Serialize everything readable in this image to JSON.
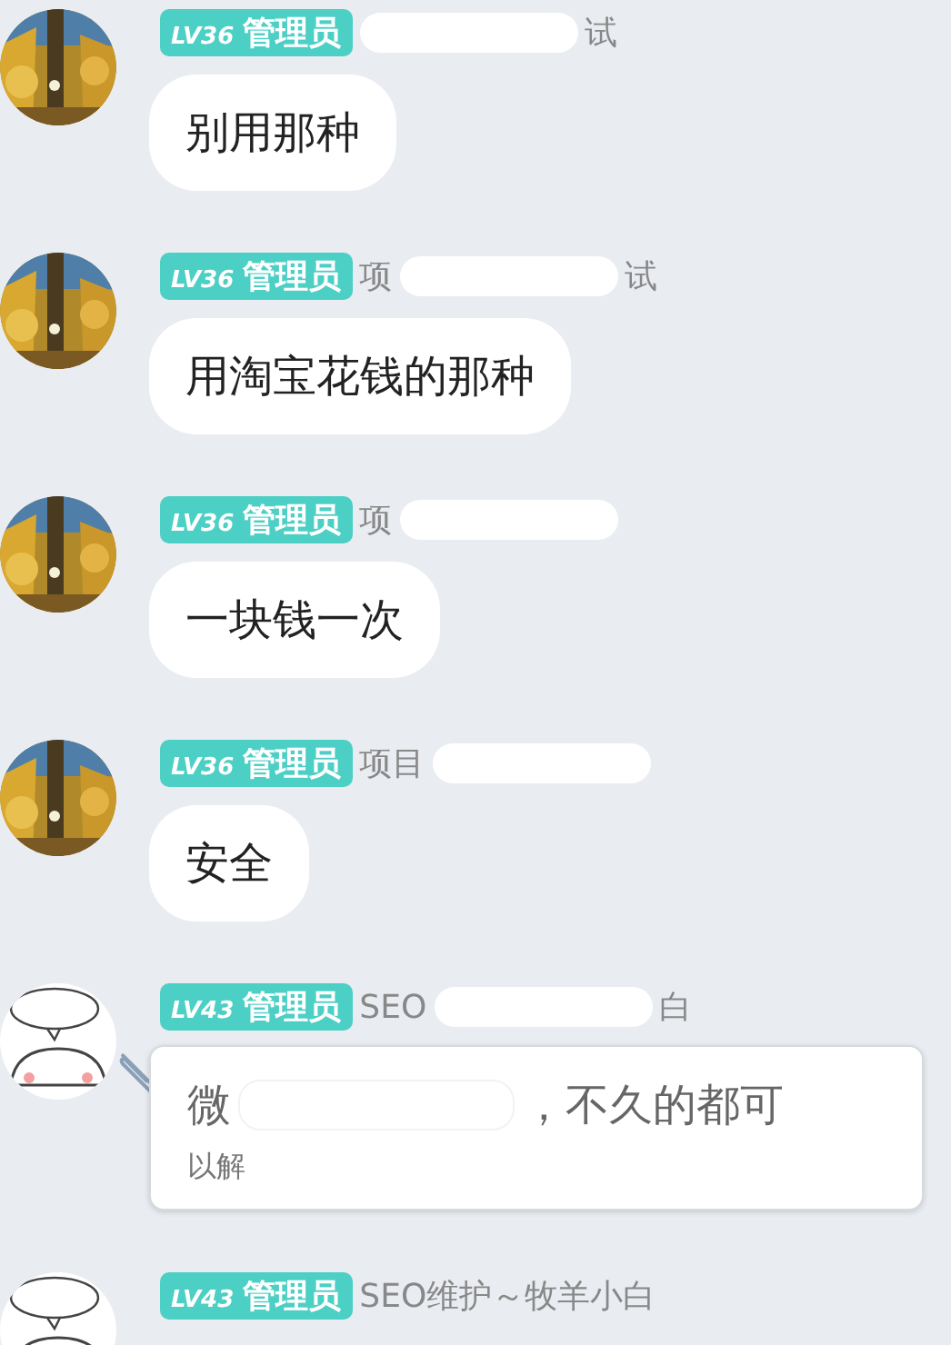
{
  "messages": [
    {
      "sender": {
        "level": "LV36",
        "role": "管理员",
        "name": [
          {
            "kind": "redacted"
          },
          {
            "kind": "text",
            "text": "试"
          }
        ]
      },
      "kind": "text",
      "text": "别用那种"
    },
    {
      "sender": {
        "level": "LV36",
        "role": "管理员",
        "name": [
          {
            "kind": "text",
            "text": "项"
          },
          {
            "kind": "redacted"
          },
          {
            "kind": "text",
            "text": "试"
          }
        ]
      },
      "kind": "text",
      "text": "用淘宝花钱的那种"
    },
    {
      "sender": {
        "level": "LV36",
        "role": "管理员",
        "name": [
          {
            "kind": "text",
            "text": "项"
          },
          {
            "kind": "redacted"
          }
        ]
      },
      "kind": "text",
      "text": "一块钱一次"
    },
    {
      "sender": {
        "level": "LV36",
        "role": "管理员",
        "name": [
          {
            "kind": "text",
            "text": "项目"
          },
          {
            "kind": "redacted"
          }
        ]
      },
      "kind": "text",
      "text": "安全"
    },
    {
      "avatar": {
        "kind": "cartoon"
      },
      "sender": {
        "level": "LV43",
        "role": "管理员",
        "name": [
          {
            "kind": "text",
            "text": "SEO"
          },
          {
            "kind": "redacted"
          },
          {
            "kind": "text",
            "text": "白"
          }
        ]
      },
      "kind": "note",
      "lines": [
        [
          {
            "kind": "text",
            "text": "微"
          },
          {
            "kind": "redacted"
          },
          {
            "kind": "text",
            "text": "，不久的都可"
          }
        ],
        [
          {
            "kind": "text",
            "text": "以解"
          }
        ]
      ]
    },
    {
      "avatar": {
        "kind": "cartoon"
      },
      "sender": {
        "level": "LV43",
        "role": "管理员",
        "name": [
          {
            "kind": "text",
            "text": "SEO维护～牧羊小白"
          }
        ]
      }
    }
  ]
}
